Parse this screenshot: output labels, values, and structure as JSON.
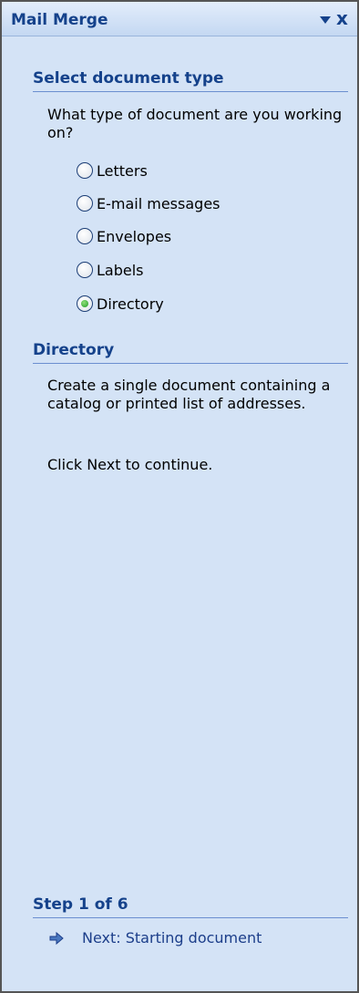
{
  "pane": {
    "title": "Mail Merge",
    "close_label": "x"
  },
  "select_type": {
    "heading": "Select document type",
    "question": "What type of document are you working on?",
    "options": [
      {
        "label": "Letters",
        "checked": false
      },
      {
        "label": "E-mail messages",
        "checked": false
      },
      {
        "label": "Envelopes",
        "checked": false
      },
      {
        "label": "Labels",
        "checked": false
      },
      {
        "label": "Directory",
        "checked": true
      }
    ]
  },
  "directory": {
    "heading": "Directory",
    "description": "Create a single document containing a catalog or printed list of addresses.",
    "instruction": "Click Next to continue."
  },
  "step": {
    "heading": "Step 1 of 6",
    "next_label": "Next: Starting document"
  },
  "colors": {
    "pane_bg": "#d4e3f6",
    "heading": "#15428b",
    "link": "#1c3e8a",
    "radio_selected": "#1f9a26"
  }
}
